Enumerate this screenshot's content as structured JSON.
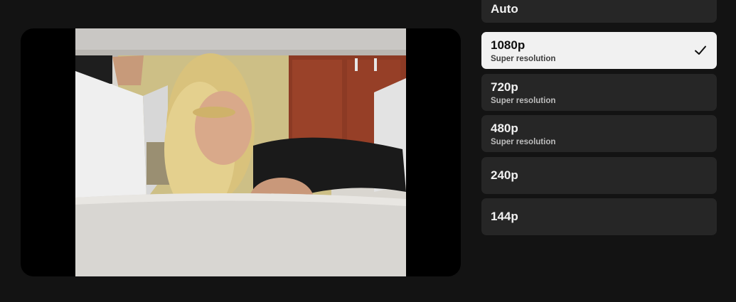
{
  "quality_menu": {
    "options": [
      {
        "label": "Auto",
        "sub": "",
        "selected": false
      },
      {
        "label": "1080p",
        "sub": "Super resolution",
        "selected": true
      },
      {
        "label": "720p",
        "sub": "Super resolution",
        "selected": false
      },
      {
        "label": "480p",
        "sub": "Super resolution",
        "selected": false
      },
      {
        "label": "240p",
        "sub": "",
        "selected": false
      },
      {
        "label": "144p",
        "sub": "",
        "selected": false
      }
    ],
    "check_icon": "checkmark-icon"
  },
  "colors": {
    "background": "#131313",
    "option_bg": "#262626",
    "selected_bg": "#f1f1f1"
  }
}
